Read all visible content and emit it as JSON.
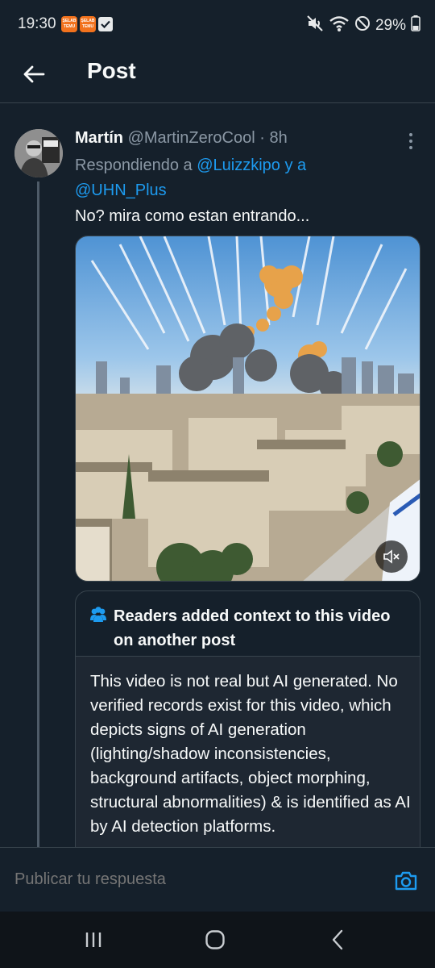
{
  "status_bar": {
    "time": "19:30",
    "temu_badge": "ŞELAB TEMU",
    "battery_percent": "29%",
    "icons": [
      "temu-app-icon",
      "temu-app-icon",
      "checkbox-icon",
      "mute-icon",
      "wifi-icon",
      "do-not-disturb-icon",
      "battery-icon"
    ]
  },
  "header": {
    "title": "Post",
    "back_icon": "arrow-left-icon"
  },
  "post": {
    "author_name": "Martín",
    "author_handle": "@MartinZeroCool",
    "separator": " · ",
    "time": "8h",
    "reply_prefix": "Respondiendo a ",
    "reply_mention_1": "@Luizzkipo",
    "reply_conjunction": " y a",
    "reply_mention_2": "@UHN_Plus",
    "text": "No? mira como estan entrando...",
    "media_icon": "volume-muted-icon"
  },
  "community_note": {
    "icon": "people-icon",
    "title": "Readers added context to this video on another post",
    "text": "This video is not real but AI generated. No verified records exist for this video, which depicts signs of AI generation (lighting/shadow inconsistencies, background artifacts, object morphing, structural abnormalities) & is identified as AI by AI detection platforms."
  },
  "reply_bar": {
    "placeholder": "Publicar tu respuesta",
    "camera_icon": "camera-icon"
  },
  "nav_bar": {
    "icons": [
      "recent-apps-icon",
      "home-icon",
      "back-icon"
    ]
  },
  "colors": {
    "background": "#15202b",
    "accent": "#1d9bf0",
    "secondary_text": "#8b98a5",
    "border": "#38444d"
  }
}
